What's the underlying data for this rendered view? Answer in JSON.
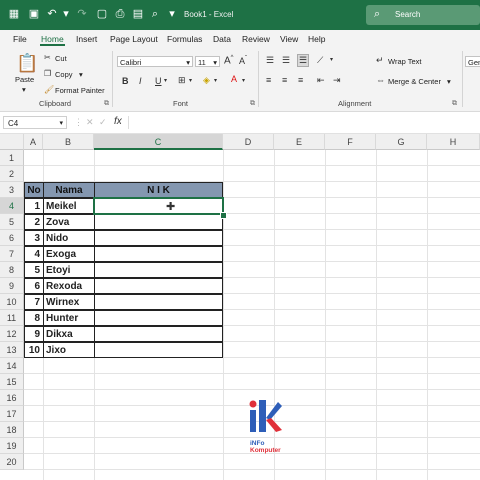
{
  "app": {
    "document_title": "Book1 - Excel",
    "search_label": "Search"
  },
  "menu": {
    "tabs": [
      "File",
      "Home",
      "Insert",
      "Page Layout",
      "Formulas",
      "Data",
      "Review",
      "View",
      "Help"
    ],
    "active": "Home"
  },
  "ribbon": {
    "clipboard": {
      "paste": "Paste",
      "cut": "Cut",
      "copy": "Copy",
      "format_painter": "Format Painter",
      "group": "Clipboard"
    },
    "font": {
      "family": "Calibri",
      "size": "11",
      "bold": "B",
      "italic": "I",
      "underline": "U",
      "group": "Font"
    },
    "alignment": {
      "wrap_text": "Wrap Text",
      "merge_center": "Merge & Center",
      "group": "Alignment"
    },
    "number": {
      "format_partial": "Gen"
    }
  },
  "formula_bar": {
    "name_box": "C4",
    "fx": "fx",
    "formula": ""
  },
  "sheet": {
    "columns": [
      "A",
      "B",
      "C",
      "D",
      "E",
      "F",
      "G",
      "H"
    ],
    "rows": [
      "1",
      "2",
      "3",
      "4",
      "5",
      "6",
      "7",
      "8",
      "9",
      "10",
      "11",
      "12",
      "13",
      "14",
      "15",
      "16",
      "17",
      "18",
      "19",
      "20"
    ],
    "table": {
      "headers": [
        "No",
        "Nama",
        "N I K"
      ],
      "rows": [
        [
          "1",
          "Meikel",
          ""
        ],
        [
          "2",
          "Zova",
          ""
        ],
        [
          "3",
          "Nido",
          ""
        ],
        [
          "4",
          "Exoga",
          ""
        ],
        [
          "5",
          "Etoyi",
          ""
        ],
        [
          "6",
          "Rexoda",
          ""
        ],
        [
          "7",
          "Wirnex",
          ""
        ],
        [
          "8",
          "Hunter",
          ""
        ],
        [
          "9",
          "Dikxa",
          ""
        ],
        [
          "10",
          "Jixo",
          ""
        ]
      ]
    }
  },
  "watermark": {
    "line1": "iNFo",
    "line2": "Komputer"
  },
  "colors": {
    "accent": "#1e7145",
    "table_header": "#8497b0"
  }
}
